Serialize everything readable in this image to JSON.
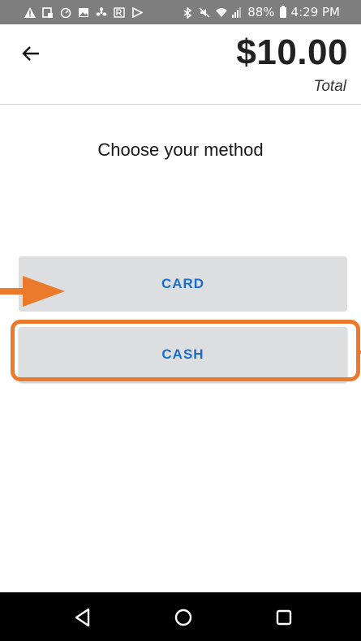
{
  "status_bar": {
    "left_icons": [
      "warning-icon",
      "screen-icon",
      "speedometer-icon",
      "image-icon",
      "fan-icon",
      "rx-icon",
      "play-icon"
    ],
    "right_icons": [
      "bluetooth-icon",
      "mute-icon",
      "wifi-icon",
      "signal-icon",
      "battery-icon"
    ],
    "battery": "88%",
    "time": "4:29 PM"
  },
  "header": {
    "total_amount": "$10.00",
    "total_label": "Total"
  },
  "main": {
    "title": "Choose your method",
    "options": [
      "CARD",
      "CASH"
    ],
    "highlighted_option": "CASH"
  },
  "colors": {
    "button_text": "#1a6ec9",
    "button_bg": "#dcdee0",
    "annotation": "#ec7a2c",
    "status_bar_bg": "#7e7e7e",
    "nav_bar_bg": "#000000"
  },
  "nav_bar": {
    "icons": [
      "back-triangle-icon",
      "home-circle-icon",
      "recents-square-icon"
    ]
  }
}
